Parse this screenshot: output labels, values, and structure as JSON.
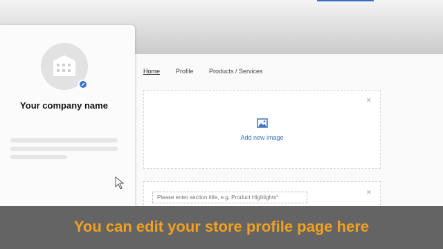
{
  "sidebar": {
    "company_name": "Your company name"
  },
  "tabs": [
    {
      "label": "Home"
    },
    {
      "label": "Profile"
    },
    {
      "label": "Products / Services"
    }
  ],
  "image_section": {
    "add_label": "Add new image",
    "close_icon": "×"
  },
  "title_section": {
    "placeholder": "Please enter section title, e.g. Product Highlights*",
    "close_icon": "×"
  },
  "caption": "You can edit your store profile page here",
  "colors": {
    "accent": "#3b71c8",
    "caption_text": "#f2a020",
    "caption_bg": "#5f5f5f"
  }
}
